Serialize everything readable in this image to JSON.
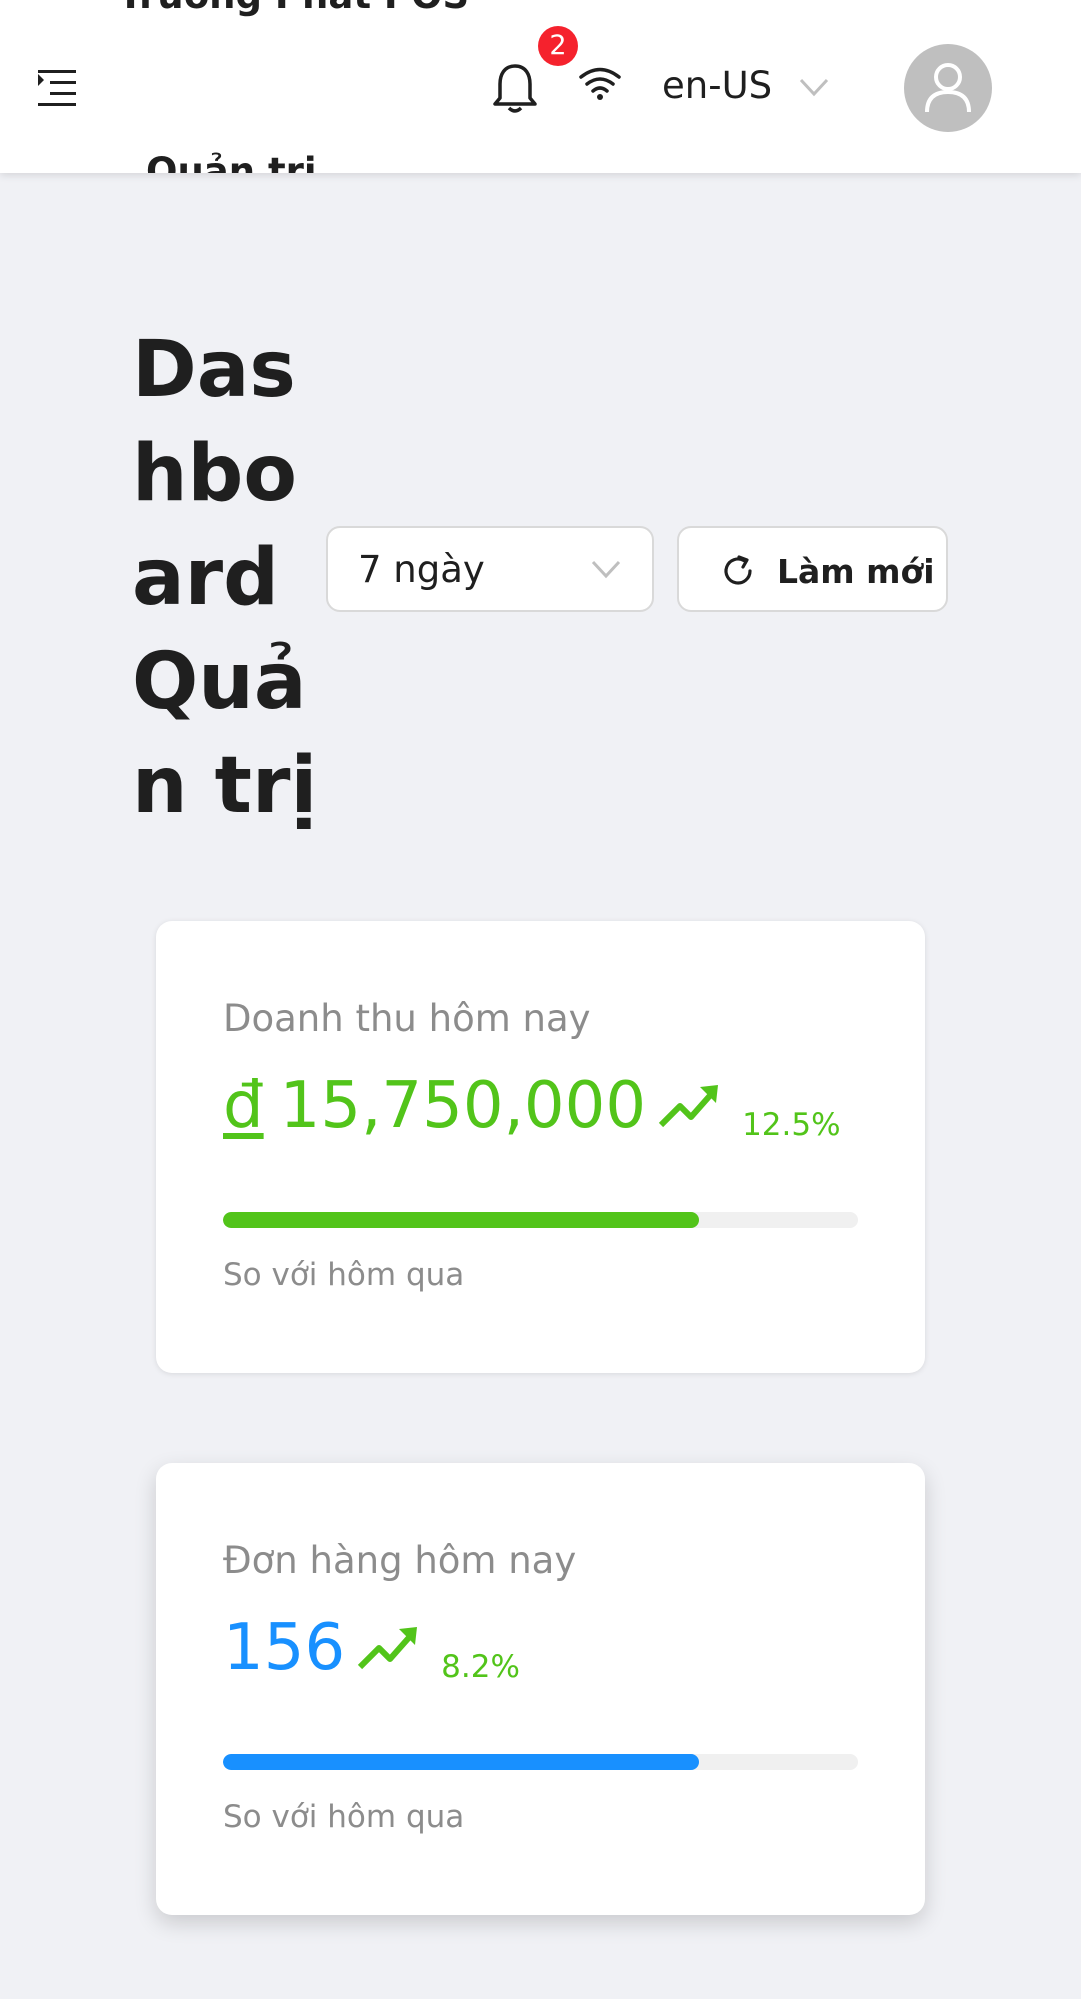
{
  "header": {
    "brand": "Trương Phát POS",
    "brand_sub": "Quản trị",
    "notification_count": "2",
    "language": "en-US",
    "icons": [
      "menu-fold-icon",
      "bell-icon",
      "wifi-icon",
      "chevron-down-icon",
      "user-icon"
    ]
  },
  "page": {
    "title": "Dashboard Quản trị",
    "range_value": "7 ngày",
    "refresh_label": "Làm mới"
  },
  "cards": [
    {
      "label": "Doanh thu hôm nay",
      "currency": "đ",
      "value": "15,750,000",
      "change": "12.5%",
      "progress_percent": 75,
      "footer": "So với hôm qua",
      "color": "#52c41a"
    },
    {
      "label": "Đơn hàng hôm nay",
      "value": "156",
      "change": "8.2%",
      "progress_percent": 75,
      "footer": "So với hôm qua",
      "color": "#1890ff"
    }
  ],
  "colors": {
    "success": "#52c41a",
    "primary": "#1890ff",
    "badge": "#f5222d",
    "background": "#f0f1f5"
  }
}
